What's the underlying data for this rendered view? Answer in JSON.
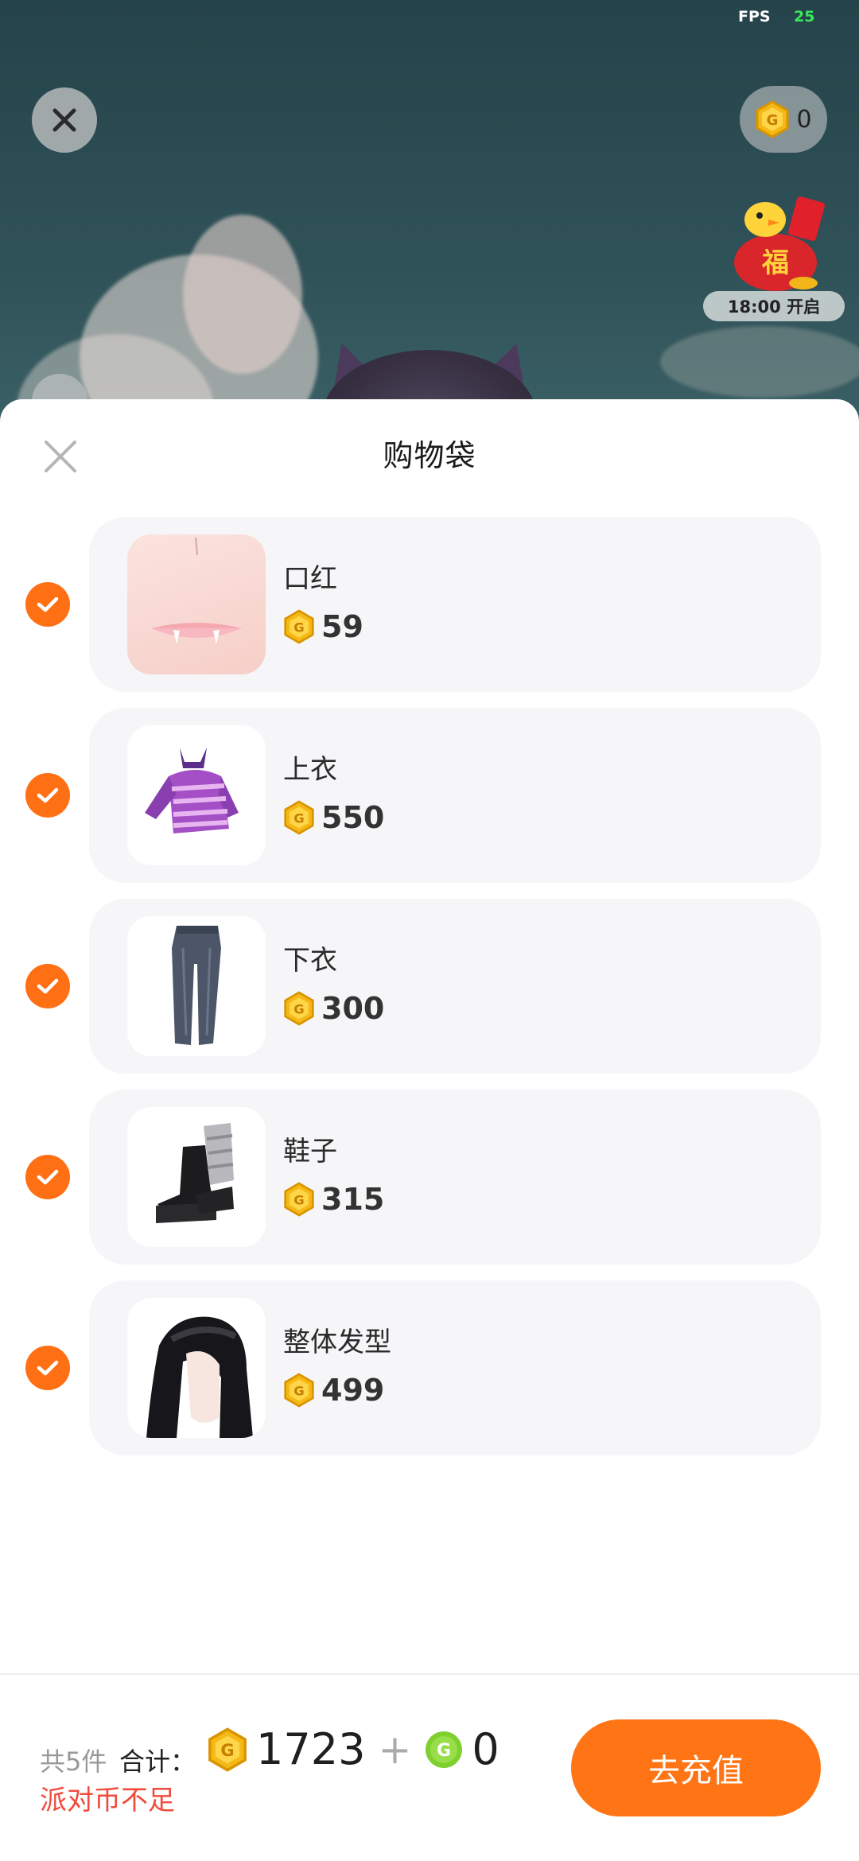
{
  "status": {
    "fps_label": "FPS",
    "fps_value": "25"
  },
  "top": {
    "coin_balance": "0",
    "lucky_bag_time": "18:00 开启"
  },
  "sheet": {
    "title": "购物袋",
    "items": [
      {
        "name": "口红",
        "price": "59",
        "icon": "lipstick-thumb"
      },
      {
        "name": "上衣",
        "price": "550",
        "icon": "hoodie-thumb"
      },
      {
        "name": "下衣",
        "price": "300",
        "icon": "jeans-thumb"
      },
      {
        "name": "鞋子",
        "price": "315",
        "icon": "boots-thumb"
      },
      {
        "name": "整体发型",
        "price": "499",
        "icon": "hair-thumb"
      }
    ]
  },
  "footer": {
    "count": "共5件",
    "total_label": "合计：",
    "gold_total": "1723",
    "plus": "+",
    "green_total": "0",
    "warning": "派对币不足",
    "recharge_label": "去充值"
  },
  "colors": {
    "accent": "#ff7414",
    "check": "#ff6f14",
    "warning": "#f04b3c",
    "coin_gold": "#f5b915",
    "coin_green": "#7fcf2f"
  }
}
